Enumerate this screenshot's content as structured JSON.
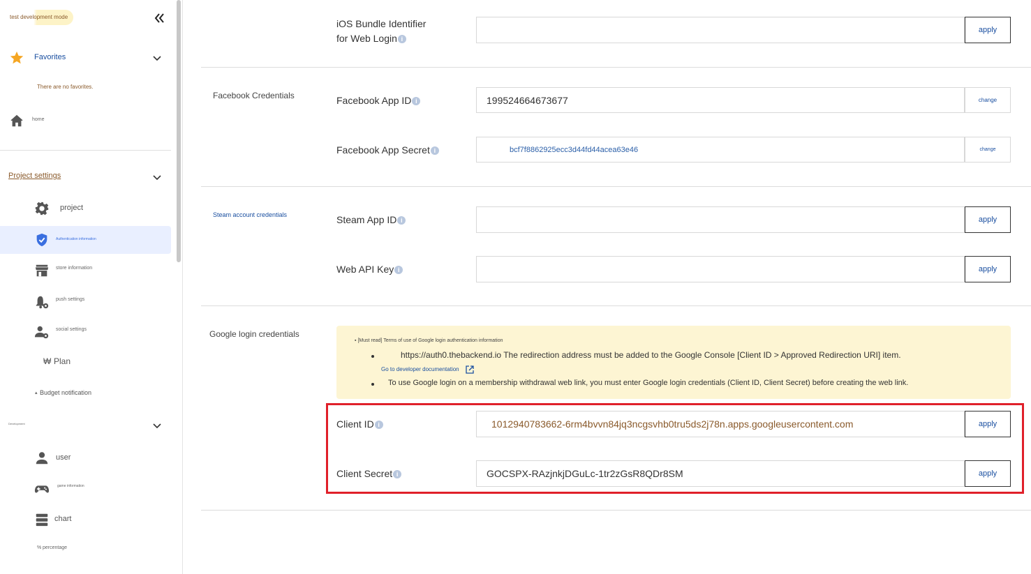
{
  "sidebar": {
    "mode_label": "test development mode",
    "favorites": {
      "label": "Favorites",
      "empty_text": "There are no favorites."
    },
    "home_label": "home",
    "project_settings": {
      "label": "Project settings",
      "items": [
        {
          "label": "project",
          "icon": "gear-icon"
        },
        {
          "label": "Authentication information",
          "icon": "shield-check-icon",
          "active": true
        },
        {
          "label": "store information",
          "icon": "store-icon"
        },
        {
          "label": "push settings",
          "icon": "bell-gear-icon"
        },
        {
          "label": "social settings",
          "icon": "user-gear-icon"
        },
        {
          "label": "Plan",
          "icon": "won-icon",
          "prefix": "₩"
        },
        {
          "label": "Budget notification",
          "icon": "triangle-icon",
          "prefix": "▴"
        }
      ]
    },
    "development": {
      "label": "Development",
      "items": [
        {
          "label": "user",
          "icon": "person-icon"
        },
        {
          "label": "game information",
          "icon": "gamepad-icon"
        },
        {
          "label": "chart",
          "icon": "database-icon"
        },
        {
          "label": "percentage",
          "icon": "percent-icon",
          "prefix": "%"
        }
      ]
    }
  },
  "main": {
    "ios": {
      "label_line1": "iOS Bundle Identifier",
      "label_line2": "for Web Login",
      "value": "",
      "button": "apply"
    },
    "facebook": {
      "title": "Facebook Credentials",
      "app_id": {
        "label": "Facebook App ID",
        "value": "199524664673677",
        "button": "change"
      },
      "app_secret": {
        "label": "Facebook App Secret",
        "value": "bcf7f8862925ecc3d44fd44acea63e46",
        "button": "change"
      }
    },
    "steam": {
      "title": "Steam account credentials",
      "app_id": {
        "label": "Steam App ID",
        "value": "",
        "button": "apply"
      },
      "web_api_key": {
        "label": "Web API Key",
        "value": "",
        "button": "apply"
      }
    },
    "google": {
      "title": "Google login credentials",
      "notice": {
        "heading": "[Must read] Terms of use of Google login authentication information",
        "item1": "https://auth0.thebackend.io The redirection address must be added to the Google Console [Client ID > Approved Redirection URI] item.",
        "link": "Go to developer documentation",
        "item2": "To use Google login on a membership withdrawal web link, you must enter Google login credentials (Client ID, Client Secret) before creating the web link."
      },
      "client_id": {
        "label": "Client ID",
        "value": "1012940783662-6rm4bvvn84jq3ncgsvhb0tru5ds2j78n.apps.googleusercontent.com",
        "button": "apply"
      },
      "client_secret": {
        "label": "Client Secret",
        "value": "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",
        "button": "apply"
      }
    }
  },
  "colors": {
    "accent": "#1a4fa0",
    "star": "#f5a623",
    "highlight_border": "#e0202a",
    "notice_bg": "#fdf5d3",
    "active_bg": "#e9efff"
  }
}
